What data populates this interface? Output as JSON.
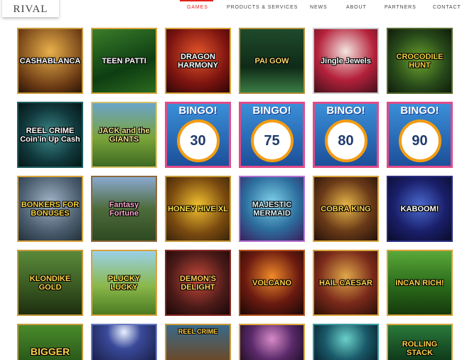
{
  "header": {
    "logo_text": "RIVAL",
    "nav": [
      {
        "label": "GAMES",
        "active": true
      },
      {
        "label": "PRODUCTS & SERVICES",
        "active": false
      },
      {
        "label": "NEWS",
        "active": false
      },
      {
        "label": "ABOUT",
        "active": false
      },
      {
        "label": "PARTNERS",
        "active": false
      },
      {
        "label": "CONTACT",
        "active": false
      }
    ]
  },
  "games": [
    [
      {
        "title": "CASHABLANCA"
      },
      {
        "title": "TEEN PATTI"
      },
      {
        "title": "DRAGON HARMONY"
      },
      {
        "title": "PAI GOW"
      },
      {
        "title": "Jingle Jewels"
      },
      {
        "title": "CROCODILE HUNT"
      }
    ],
    [
      {
        "title": "REEL CRIME Coin'in Up Cash"
      },
      {
        "title": "JACK and the GIANTS"
      },
      {
        "title": "BINGO!",
        "number": "30"
      },
      {
        "title": "BINGO!",
        "number": "75"
      },
      {
        "title": "BINGO!",
        "number": "80"
      },
      {
        "title": "BINGO!",
        "number": "90"
      }
    ],
    [
      {
        "title": "BONKERS FOR BONUSES"
      },
      {
        "title": "Fantasy Fortune"
      },
      {
        "title": "HONEY HIVE XL"
      },
      {
        "title": "MAJESTIC MERMAID"
      },
      {
        "title": "COBRA KING"
      },
      {
        "title": "KABOOM!"
      }
    ],
    [
      {
        "title": "KLONDIKE GOLD"
      },
      {
        "title": "PLUCKY LUCKY"
      },
      {
        "title": "DEMON'S DELIGHT"
      },
      {
        "title": "VOLCANO"
      },
      {
        "title": "HAIL CAESAR"
      },
      {
        "title": "INCAN RICH!"
      }
    ],
    [
      {
        "title": "BIGGER"
      },
      {
        "title": ""
      },
      {
        "title": "REEL CRIME"
      },
      {
        "title": ""
      },
      {
        "title": ""
      },
      {
        "title": "ROLLING STACK"
      }
    ]
  ],
  "colors": {
    "nav_active": "#e2231a",
    "nav_text": "#444444",
    "tile_border_gold": "#d8a33a"
  }
}
